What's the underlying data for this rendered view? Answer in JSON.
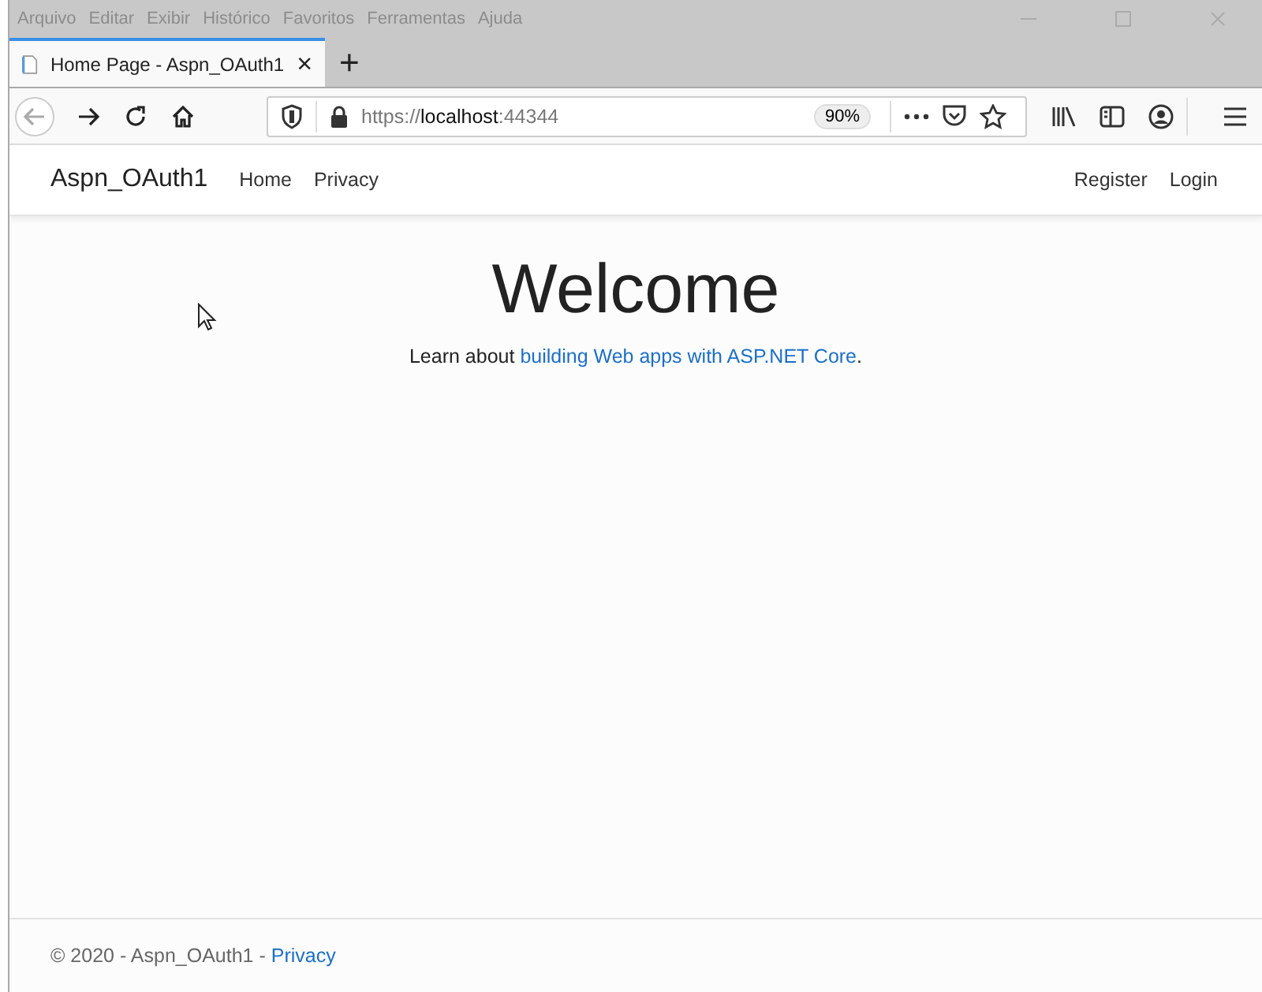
{
  "menu_bar": {
    "items": [
      "Arquivo",
      "Editar",
      "Exibir",
      "Histórico",
      "Favoritos",
      "Ferramentas",
      "Ajuda"
    ]
  },
  "tabs": [
    {
      "title": "Home Page - Aspn_OAuth1",
      "selected": true,
      "close": "×"
    }
  ],
  "new_tab": "+",
  "address_bar": {
    "scheme": "https://",
    "host": "localhost",
    "port": ":44344",
    "zoom": "90%"
  },
  "navbar": {
    "brand": "Aspn_OAuth1",
    "links": [
      "Home",
      "Privacy"
    ],
    "right_links": [
      "Register",
      "Login"
    ]
  },
  "hero": {
    "title": "Welcome",
    "text": "Learn about ",
    "link": "building Web apps with ASP.NET Core",
    "after": "."
  },
  "footer": {
    "text": "© 2020 - Aspn_OAuth1 - ",
    "link": "Privacy"
  }
}
